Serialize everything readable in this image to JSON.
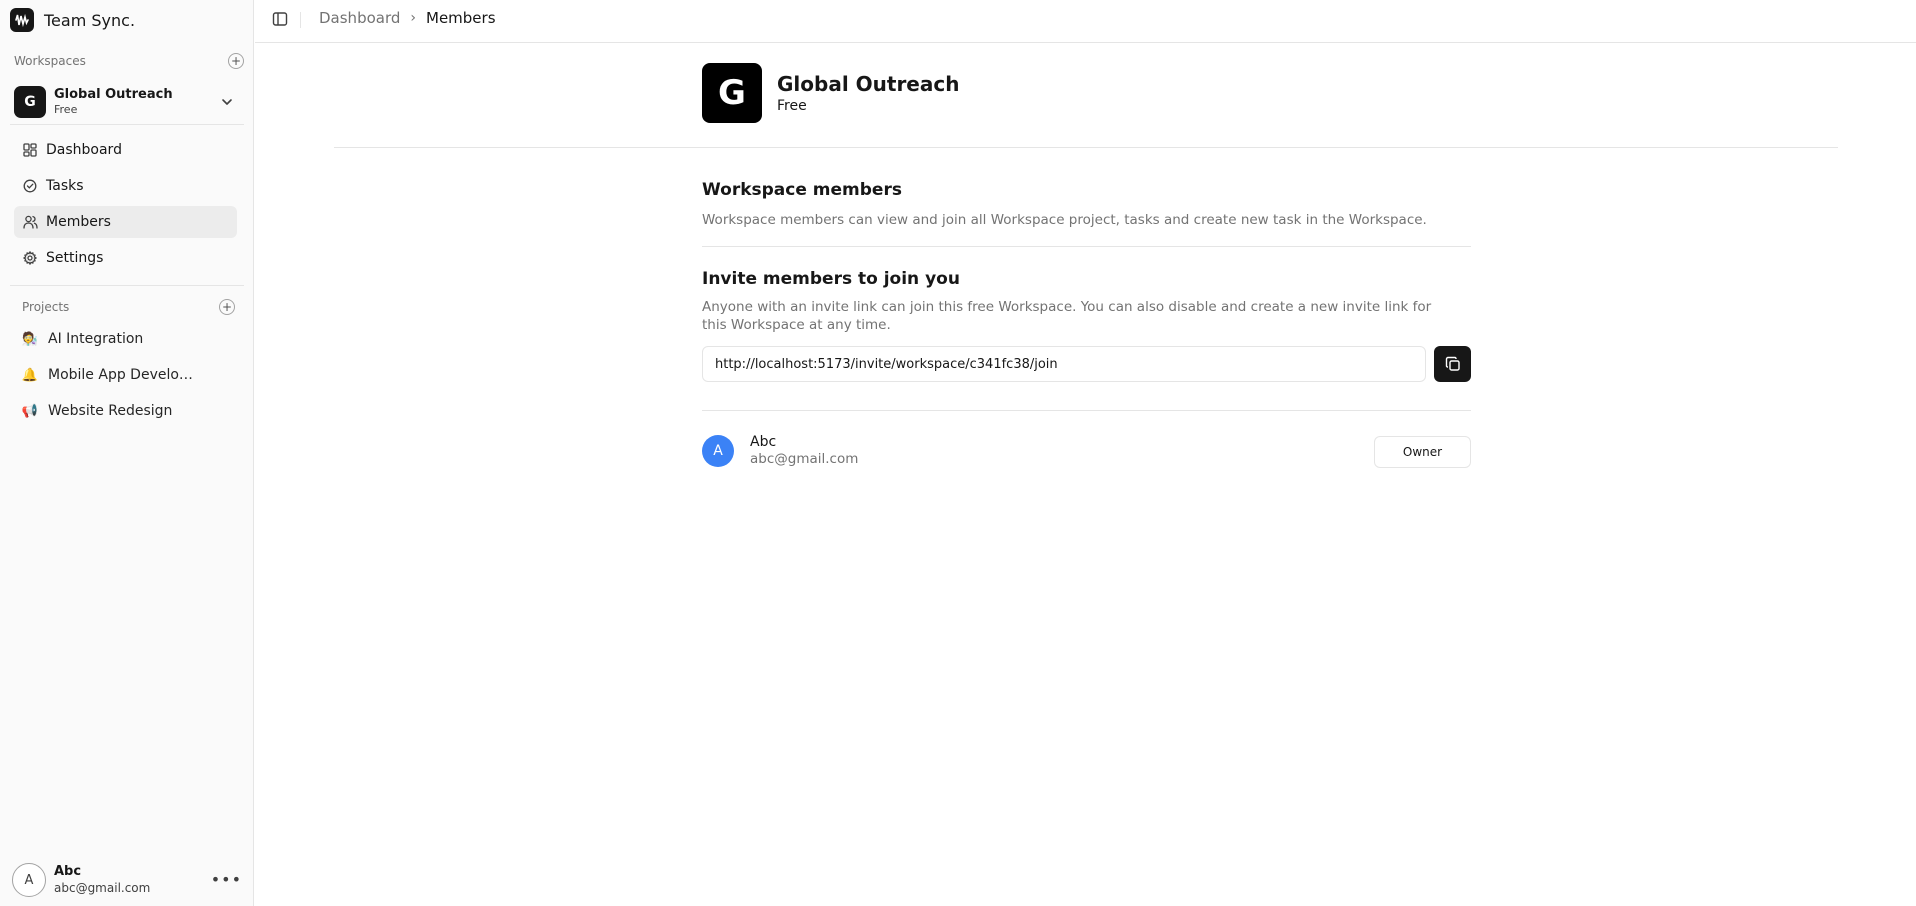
{
  "app": {
    "name": "Team Sync."
  },
  "sidebar": {
    "workspaces_label": "Workspaces",
    "current_workspace": {
      "initial": "G",
      "name": "Global Outreach",
      "plan": "Free"
    },
    "nav": [
      {
        "label": "Dashboard",
        "icon": "dashboard-icon",
        "active": false
      },
      {
        "label": "Tasks",
        "icon": "check-circle-icon",
        "active": false
      },
      {
        "label": "Members",
        "icon": "users-icon",
        "active": true
      },
      {
        "label": "Settings",
        "icon": "gear-icon",
        "active": false
      }
    ],
    "projects_label": "Projects",
    "projects": [
      {
        "emoji": "🧑‍🔬",
        "label": "AI Integration"
      },
      {
        "emoji": "🔔",
        "label": "Mobile App Development"
      },
      {
        "emoji": "📢",
        "label": "Website Redesign"
      }
    ],
    "user": {
      "initial": "A",
      "name": "Abc",
      "email": "abc@gmail.com"
    }
  },
  "header": {
    "breadcrumb": {
      "parent": "Dashboard",
      "current": "Members"
    }
  },
  "workspace": {
    "initial": "G",
    "name": "Global Outreach",
    "plan": "Free"
  },
  "members_section": {
    "title": "Workspace members",
    "description": "Workspace members can view and join all Workspace project, tasks and create new task in the Workspace."
  },
  "invite_section": {
    "title": "Invite members to join you",
    "description": "Anyone with an invite link can join this free Workspace. You can also disable and create a new invite link for this Workspace at any time.",
    "invite_link": "http://localhost:5173/invite/workspace/c341fc38/join"
  },
  "members": [
    {
      "initial": "A",
      "name": "Abc",
      "email": "abc@gmail.com",
      "role": "Owner"
    }
  ],
  "colors": {
    "accent": "#171717",
    "member_avatar": "#3b82f6",
    "sidebar_bg": "#fafafa"
  }
}
